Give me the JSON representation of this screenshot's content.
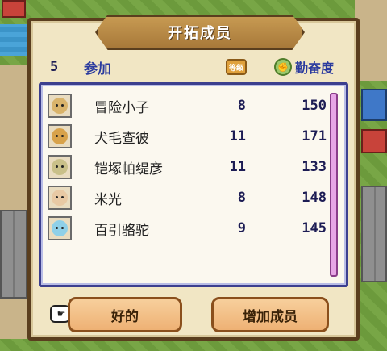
{
  "dialog": {
    "title": "开拓成员",
    "participant_count": "5",
    "participant_label": "参加",
    "level_badge_text": "等级",
    "diligence_label": "勤奋度",
    "diligence_icon": "muscle-icon"
  },
  "members": [
    {
      "name": "冒险小子",
      "level": "8",
      "diligence": "150",
      "avatar_color": "#d9b36a"
    },
    {
      "name": "犬毛查彼",
      "level": "11",
      "diligence": "171",
      "avatar_color": "#d8a24a"
    },
    {
      "name": "铠塚帕缇彦",
      "level": "11",
      "diligence": "133",
      "avatar_color": "#c9c089"
    },
    {
      "name": "米光",
      "level": "8",
      "diligence": "148",
      "avatar_color": "#e8c9a4"
    },
    {
      "name": "百引骆驼",
      "level": "9",
      "diligence": "145",
      "avatar_color": "#8fd0e8"
    }
  ],
  "buttons": {
    "ok_label": "好的",
    "add_label": "增加成员",
    "pointer_icon": "pointing-hand-icon"
  },
  "colors": {
    "panel_border": "#3c3f8e",
    "text_blue": "#2a3a9e",
    "button_fill": "#eeb174",
    "scrollbar": "#e7a6e6"
  }
}
